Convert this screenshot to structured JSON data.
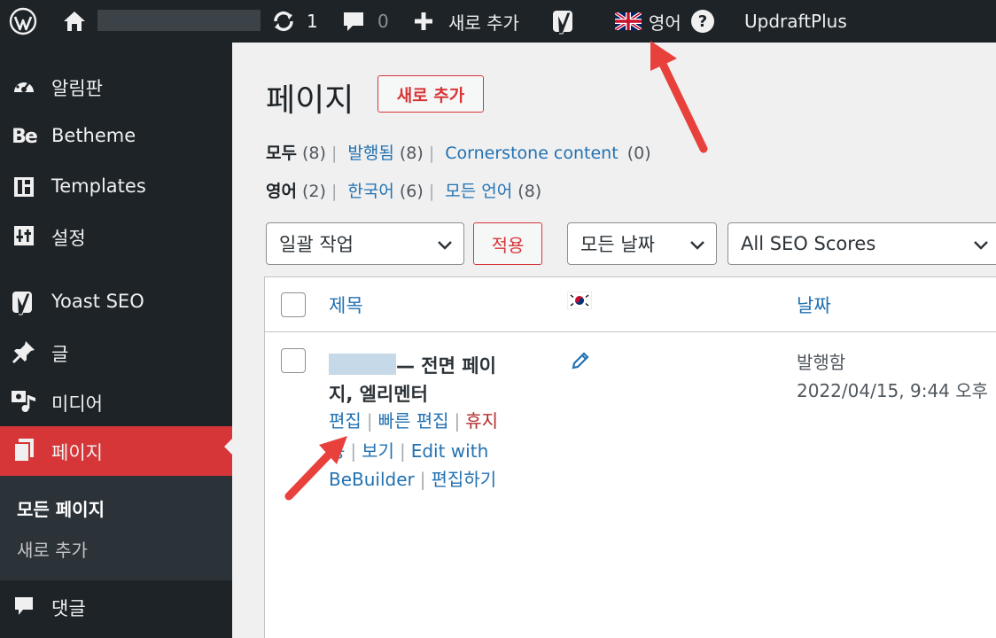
{
  "adminbar": {
    "comments_count": "0",
    "updates_count": "1",
    "new_label": "새로 추가",
    "language_label": "영어",
    "help_label": "?",
    "updraft_label": "UpdraftPlus"
  },
  "sidebar": {
    "items": [
      {
        "label": "알림판"
      },
      {
        "label": "Betheme"
      },
      {
        "label": "Templates"
      },
      {
        "label": "설정"
      },
      {
        "label": "Yoast SEO"
      },
      {
        "label": "글"
      },
      {
        "label": "미디어"
      },
      {
        "label": "페이지"
      },
      {
        "label": "댓글"
      }
    ],
    "betheme_icon_text": "Be",
    "submenu": [
      {
        "label": "모든 페이지"
      },
      {
        "label": "새로 추가"
      }
    ]
  },
  "main": {
    "title": "페이지",
    "add_new": "새로 추가",
    "status_filters": {
      "all": "모두",
      "all_count": "(8)",
      "published": "발행됨",
      "published_count": "(8)",
      "cornerstone": "Cornerstone content",
      "cornerstone_count": "(0)"
    },
    "lang_filters": {
      "english": "영어",
      "english_count": "(2)",
      "korean": "한국어",
      "korean_count": "(6)",
      "all_languages": "모든 언어",
      "all_languages_count": "(8)"
    },
    "separator": "|",
    "bulk_action": "일괄 작업",
    "apply": "적용",
    "all_dates": "모든 날짜",
    "seo_scores": "All SEO Scores",
    "table": {
      "col_title": "제목",
      "col_date": "날짜",
      "row": {
        "title_suffix": "— 전면 페이지, 엘리멘터",
        "status": "발행함",
        "date": "2022/04/15, 9:44 오후",
        "actions": {
          "edit": "편집",
          "quick_edit": "빠른 편집",
          "trash": "휴지",
          "partial": "동",
          "view": "보기",
          "edit_with": "Edit with",
          "bebuilder": "BeBuilder",
          "edit_short": "편집하기"
        }
      }
    }
  },
  "colors": {
    "adminbar": "#1d2327",
    "active": "#d63638",
    "link": "#2271b1",
    "annotation": "#e8413c"
  }
}
